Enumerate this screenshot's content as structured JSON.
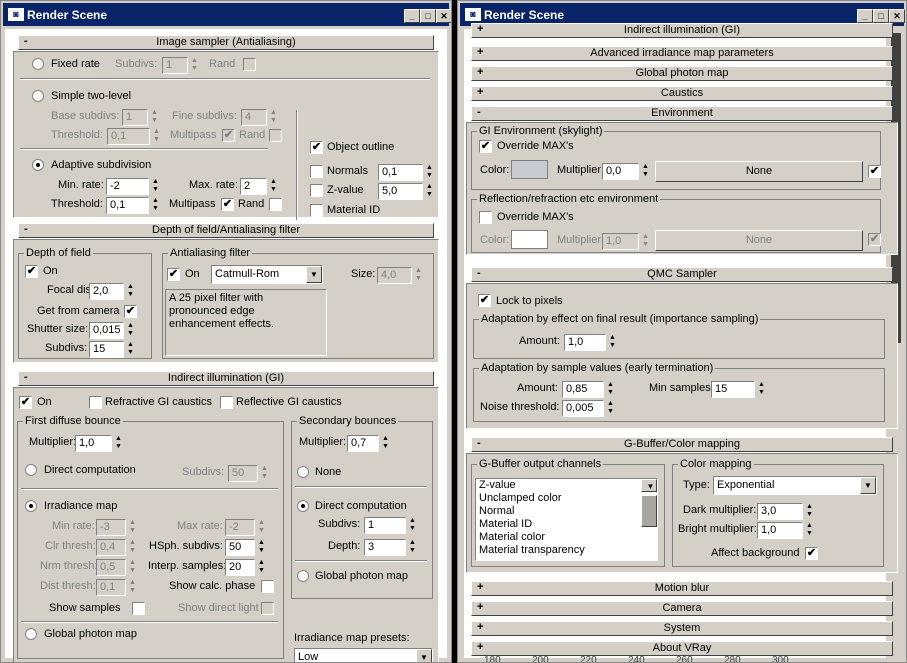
{
  "w1": {
    "title": "Render Scene"
  },
  "w2": {
    "title": "Render Scene"
  },
  "w1p": {
    "is_title": "Image sampler (Antialiasing)",
    "fixed_rate": "Fixed rate",
    "fr_subdivs_lbl": "Subdivs:",
    "fr_subdivs": "1",
    "fr_rand": "Rand",
    "simple": "Simple two-level",
    "base_subdivs_lbl": "Base subdivs:",
    "base_subdivs": "1",
    "fine_subdivs_lbl": "Fine subdivs:",
    "fine_subdivs": "4",
    "threshold_lbl": "Threshold:",
    "st_threshold": "0,1",
    "multipass": "Multipass",
    "st_rand": "Rand",
    "adaptive": "Adaptive subdivision",
    "min_rate_lbl": "Min. rate:",
    "min_rate": "-2",
    "max_rate_lbl": "Max. rate:",
    "max_rate": "2",
    "ad_threshold": "0,1",
    "ad_multipass": "Multipass",
    "ad_rand": "Rand",
    "object_outline": "Object outline",
    "normals": "Normals",
    "normals_val": "0,1",
    "zvalue": "Z-value",
    "zvalue_val": "5,0",
    "material_id": "Material ID",
    "dof_title": "Depth of field/Antialiasing filter",
    "dof_group": "Depth of field",
    "dof_on": "On",
    "focal_dist_lbl": "Focal dist:",
    "focal_dist": "2,0",
    "get_from_camera": "Get from camera",
    "shutter_size_lbl": "Shutter size:",
    "shutter_size": "0,015",
    "subdivs_lbl": "Subdivs:",
    "dof_subdivs": "15",
    "aa_group": "Antialiasing filter",
    "aa_on": "On",
    "aa_filter": "Catmull-Rom",
    "size_lbl": "Size:",
    "aa_size": "4,0",
    "aa_desc": "A 25 pixel filter with pronounced edge enhancement effects.",
    "gi_title": "Indirect illumination (GI)",
    "gi_on": "On",
    "refr_gi": "Refractive GI caustics",
    "refl_gi": "Reflective GI caustics",
    "fdb_group": "First diffuse bounce",
    "fdb_mult_lbl": "Multiplier:",
    "fdb_mult": "1,0",
    "direct_comp": "Direct computation",
    "dc_subdivs_lbl": "Subdivs:",
    "dc_subdivs": "50",
    "irr_map": "Irradiance map",
    "im_min_rate_lbl": "Min rate:",
    "im_min_rate": "-3",
    "im_max_rate_lbl": "Max rate:",
    "im_max_rate": "-2",
    "clr_thresh_lbl": "Clr thresh:",
    "clr_thresh": "0,4",
    "hsph_lbl": "HSph. subdivs:",
    "hsph": "50",
    "nrm_thresh_lbl": "Nrm thresh:",
    "nrm_thresh": "0,5",
    "interp_lbl": "Interp. samples:",
    "interp": "20",
    "dist_thresh_lbl": "Dist thresh:",
    "dist_thresh": "0,1",
    "show_calc": "Show calc. phase",
    "show_samples": "Show samples",
    "show_direct": "Show direct light",
    "global_photon": "Global photon map",
    "sb_group": "Secondary bounces",
    "sb_mult_lbl": "Multiplier:",
    "sb_mult": "0,7",
    "sb_none": "None",
    "sb_direct": "Direct computation",
    "sb_subdivs_lbl": "Subdivs:",
    "sb_subdivs": "1",
    "sb_depth_lbl": "Depth:",
    "sb_depth": "3",
    "sb_global": "Global photon map",
    "presets_lbl": "Irradiance map presets:",
    "presets": "Low"
  },
  "w2p": {
    "top_partial": "Indirect illumination (GI)",
    "rollouts": [
      "Advanced irradiance map parameters",
      "Global photon map",
      "Caustics"
    ],
    "env_title": "Environment",
    "gi_env_group": "GI Environment (skylight)",
    "gi_override": "Override MAX's",
    "color_lbl": "Color:",
    "mult_lbl": "Multiplier:",
    "gi_mult": "0,0",
    "gi_map": "None",
    "refl_group": "Reflection/refraction etc environment",
    "refl_override": "Override MAX's",
    "refl_mult": "1,0",
    "refl_map": "None",
    "qmc_title": "QMC Sampler",
    "lock_pixels": "Lock to pixels",
    "afr_group": "Adaptation by effect on final result (importance sampling)",
    "amount_lbl": "Amount:",
    "afr_amount": "1,0",
    "asv_group": "Adaptation by sample values (early termination)",
    "asv_amount": "0,85",
    "min_samples_lbl": "Min samples:",
    "min_samples": "15",
    "noise_lbl": "Noise threshold:",
    "noise": "0,005",
    "gb_title": "G-Buffer/Color mapping",
    "gb_group": "G-Buffer output channels",
    "channels": [
      "Z-value",
      "Unclamped color",
      "Normal",
      "Material ID",
      "Material color",
      "Material transparency"
    ],
    "cm_group": "Color mapping",
    "type_lbl": "Type:",
    "cm_type": "Exponential",
    "dark_lbl": "Dark multiplier:",
    "dark": "3,0",
    "bright_lbl": "Bright multiplier:",
    "bright": "1,0",
    "affect_bg": "Affect background",
    "bottom": [
      "Motion blur",
      "Camera",
      "System",
      "About VRay"
    ],
    "ruler": [
      "180",
      "200",
      "220",
      "240",
      "260",
      "280",
      "300"
    ]
  }
}
